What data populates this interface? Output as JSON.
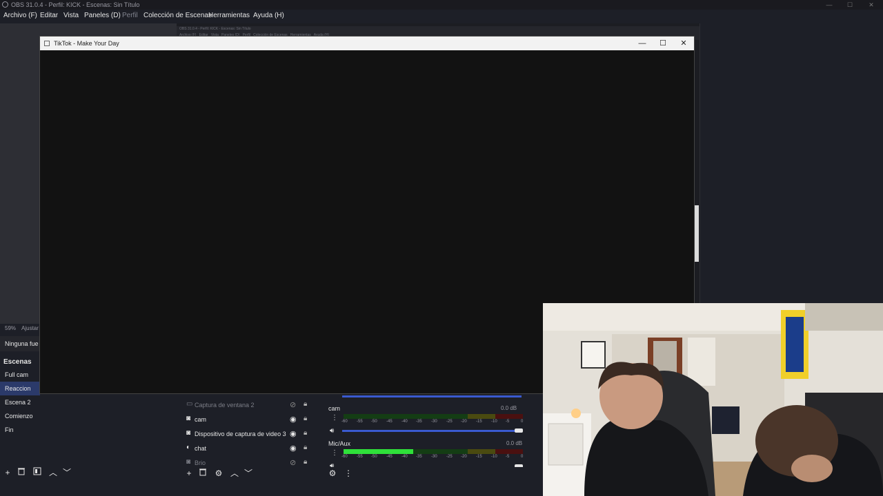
{
  "obs": {
    "window_title": "OBS 31.0.4 - Perfil: KICK - Escenas: Sin Título",
    "menu": [
      "Archivo (F)",
      "Editar",
      "Vista",
      "Paneles (D)",
      "Perfil",
      "Colección de Escenas",
      "Herramientas",
      "Ayuda (H)"
    ],
    "nested_title": "OBS 31.0.4 - Perfil: KICK - Escenas: Sin Título",
    "nested_menu": "Archivo (F)   Editar   Vista   Paneles (D)   Perfil   Colección de Escenas   Herramientas   Ayuda (H)",
    "zoom": "59%",
    "zoom_mode": "Ajustar",
    "no_source": "Ninguna fue"
  },
  "tiktok": {
    "title": "TikTok - Make Your Day",
    "minimize": "—",
    "maximize": "☐",
    "close": "✕"
  },
  "scenes": {
    "header": "Escenas",
    "items": [
      "Full cam",
      "Reaccion",
      "Escena 2",
      "Comienzo",
      "Fin"
    ],
    "selected": "Reaccion"
  },
  "sources": {
    "items": [
      {
        "name": "Captura de ventana 2",
        "icon": "window-capture-icon",
        "visible": false
      },
      {
        "name": "cam",
        "icon": "camera-icon",
        "visible": true
      },
      {
        "name": "Dispositivo de captura de video 3",
        "icon": "camera-icon",
        "visible": true
      },
      {
        "name": "chat",
        "icon": "browser-icon",
        "visible": true
      },
      {
        "name": "Brio",
        "icon": "camera-icon",
        "visible": false
      }
    ]
  },
  "mixer": {
    "channels": [
      {
        "name": "cam",
        "db": "0.0 dB",
        "level": 0
      },
      {
        "name": "Mic/Aux",
        "db": "0.0 dB",
        "level": 0.39
      }
    ],
    "scale": [
      "-60",
      "-55",
      "-50",
      "-45",
      "-40",
      "-35",
      "-30",
      "-25",
      "-20",
      "-15",
      "-10",
      "-5",
      "0"
    ]
  },
  "colors": {
    "accent": "#2b3a6a",
    "meter_green": "#2fe03a"
  }
}
